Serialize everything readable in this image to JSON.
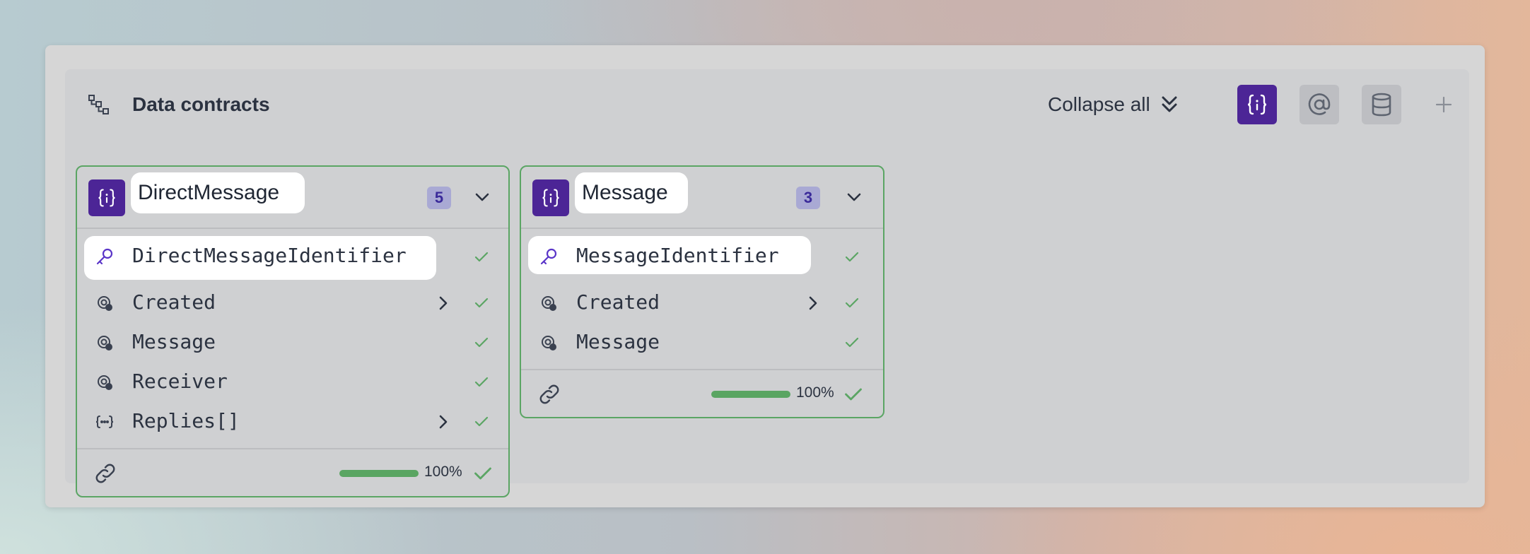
{
  "header": {
    "title": "Data contracts",
    "collapse_label": "Collapse all"
  },
  "toolbar": {
    "icons": [
      "object-braces-icon",
      "at-sign-icon",
      "database-icon",
      "plus-icon"
    ],
    "active_color": "#4c2596"
  },
  "contracts": [
    {
      "name": "DirectMessage",
      "count": "5",
      "fields": [
        {
          "icon": "key-icon",
          "label": "DirectMessageIdentifier",
          "expandable": false,
          "valid": true
        },
        {
          "icon": "reference-icon",
          "label": "Created",
          "expandable": true,
          "valid": true
        },
        {
          "icon": "reference-icon",
          "label": "Message",
          "expandable": false,
          "valid": true
        },
        {
          "icon": "reference-icon",
          "label": "Receiver",
          "expandable": false,
          "valid": true
        },
        {
          "icon": "array-icon",
          "label": "Replies[]",
          "expandable": true,
          "valid": true
        }
      ],
      "progress_pct": 100,
      "progress_label": "100%"
    },
    {
      "name": "Message",
      "count": "3",
      "fields": [
        {
          "icon": "key-icon",
          "label": "MessageIdentifier",
          "expandable": false,
          "valid": true
        },
        {
          "icon": "reference-icon",
          "label": "Created",
          "expandable": true,
          "valid": true
        },
        {
          "icon": "reference-icon",
          "label": "Message",
          "expandable": false,
          "valid": true
        }
      ],
      "progress_pct": 100,
      "progress_label": "100%"
    }
  ],
  "colors": {
    "accent": "#4c2596",
    "valid": "#5ba564",
    "text": "#2b3240"
  }
}
